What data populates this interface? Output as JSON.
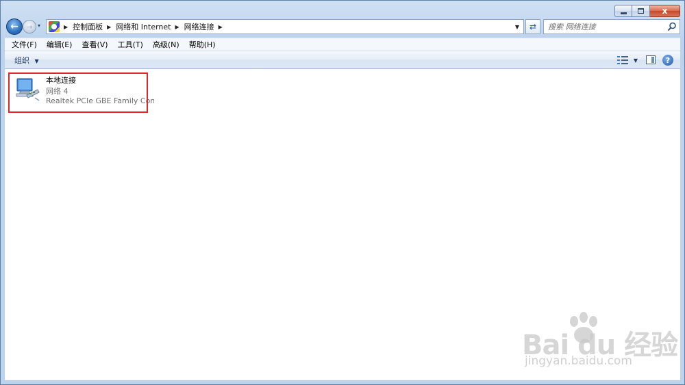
{
  "window": {
    "minimize_label": "",
    "maximize_label": "",
    "close_label": "x"
  },
  "nav": {
    "back_glyph": "←",
    "forward_glyph": "→",
    "recent_glyph": "▾"
  },
  "address": {
    "crumbs": [
      "控制面板",
      "网络和 Internet",
      "网络连接"
    ],
    "separator": "▶",
    "dropdown_glyph": "▼"
  },
  "refresh": {
    "glyph": "⇄"
  },
  "search": {
    "placeholder": "搜索 网络连接"
  },
  "menu": {
    "items": [
      "文件(F)",
      "编辑(E)",
      "查看(V)",
      "工具(T)",
      "高级(N)",
      "帮助(H)"
    ]
  },
  "toolbar": {
    "organize_label": "组织",
    "dropdown_glyph": "▼",
    "help_glyph": "?"
  },
  "connection": {
    "name": "本地连接",
    "network": "网络  4",
    "adapter": "Realtek PCIe GBE Family Contr..."
  },
  "watermark": {
    "logo_text": "Bai  du 经验",
    "url": "jingyan.baidu.com"
  },
  "colors": {
    "highlight": "#e0262d",
    "chrome": "#bcd3ee"
  }
}
